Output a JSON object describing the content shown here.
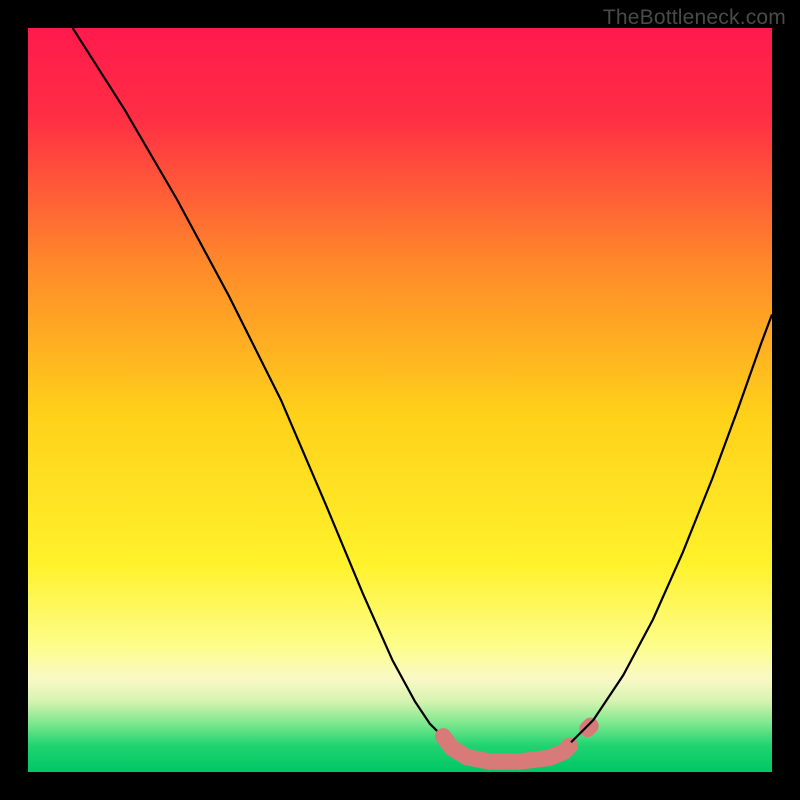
{
  "watermark": "TheBottleneck.com",
  "chart_data": {
    "type": "line",
    "title": "",
    "xlabel": "",
    "ylabel": "",
    "xlim_frac": [
      0,
      1
    ],
    "ylim_frac": [
      0,
      1
    ],
    "gradient_stops": [
      {
        "pos": 0.0,
        "color": "#ff1a4d"
      },
      {
        "pos": 0.12,
        "color": "#ff2e44"
      },
      {
        "pos": 0.32,
        "color": "#ff8a2a"
      },
      {
        "pos": 0.52,
        "color": "#ffd11a"
      },
      {
        "pos": 0.72,
        "color": "#fff22b"
      },
      {
        "pos": 0.83,
        "color": "#fdfd8a"
      },
      {
        "pos": 0.875,
        "color": "#faf9c6"
      },
      {
        "pos": 0.905,
        "color": "#d6f3b0"
      },
      {
        "pos": 0.935,
        "color": "#7be88e"
      },
      {
        "pos": 0.965,
        "color": "#1fd370"
      },
      {
        "pos": 1.0,
        "color": "#00c765"
      }
    ],
    "series": [
      {
        "name": "left_curve",
        "stroke": "#000000",
        "points_frac": [
          [
            0.06,
            0.0
          ],
          [
            0.13,
            0.11
          ],
          [
            0.2,
            0.23
          ],
          [
            0.27,
            0.36
          ],
          [
            0.34,
            0.5
          ],
          [
            0.4,
            0.64
          ],
          [
            0.45,
            0.76
          ],
          [
            0.49,
            0.85
          ],
          [
            0.52,
            0.905
          ],
          [
            0.54,
            0.935
          ],
          [
            0.555,
            0.95
          ]
        ]
      },
      {
        "name": "flat_segment_1",
        "stroke": "#d77a78",
        "stroke_width_frac": 0.022,
        "linecap": "round",
        "points_frac": [
          [
            0.558,
            0.952
          ],
          [
            0.57,
            0.968
          ],
          [
            0.59,
            0.98
          ],
          [
            0.62,
            0.986
          ],
          [
            0.66,
            0.986
          ],
          [
            0.7,
            0.981
          ],
          [
            0.72,
            0.973
          ],
          [
            0.728,
            0.965
          ]
        ]
      },
      {
        "name": "flat_dot",
        "stroke": "#d77a78",
        "stroke_width_frac": 0.022,
        "linecap": "round",
        "points_frac": [
          [
            0.752,
            0.942
          ],
          [
            0.756,
            0.938
          ]
        ]
      },
      {
        "name": "right_curve",
        "stroke": "#000000",
        "points_frac": [
          [
            0.73,
            0.96
          ],
          [
            0.76,
            0.93
          ],
          [
            0.8,
            0.87
          ],
          [
            0.84,
            0.795
          ],
          [
            0.88,
            0.705
          ],
          [
            0.92,
            0.605
          ],
          [
            0.955,
            0.51
          ],
          [
            0.985,
            0.425
          ],
          [
            1.0,
            0.385
          ]
        ]
      }
    ]
  }
}
